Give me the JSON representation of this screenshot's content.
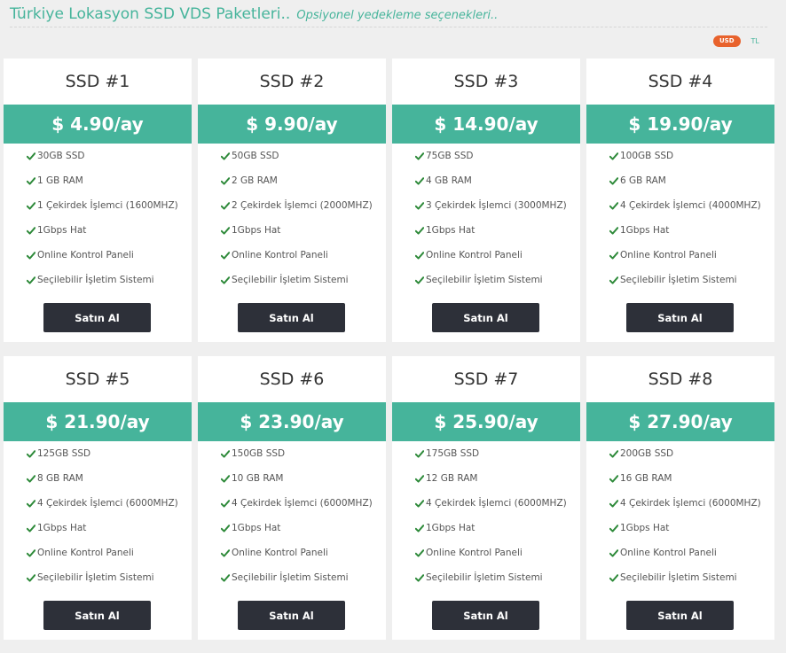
{
  "header": {
    "title": "Türkiye Lokasyon SSD VDS Paketleri..",
    "subtitle": "Opsiyonel yedekleme seçenekleri.."
  },
  "currency": {
    "active": "USD",
    "alt": "TL"
  },
  "plans": [
    {
      "name": "SSD #1",
      "price": "$ 4.90/ay",
      "features": [
        "30GB SSD",
        "1 GB RAM",
        "1 Çekirdek İşlemci (1600MHZ)",
        "1Gbps Hat",
        "Online Kontrol Paneli",
        "Seçilebilir İşletim Sistemi"
      ],
      "button": "Satın Al"
    },
    {
      "name": "SSD #2",
      "price": "$ 9.90/ay",
      "features": [
        "50GB SSD",
        "2 GB RAM",
        "2 Çekirdek İşlemci (2000MHZ)",
        "1Gbps Hat",
        "Online Kontrol Paneli",
        "Seçilebilir İşletim Sistemi"
      ],
      "button": "Satın Al"
    },
    {
      "name": "SSD #3",
      "price": "$ 14.90/ay",
      "features": [
        "75GB SSD",
        "4 GB RAM",
        "3 Çekirdek İşlemci (3000MHZ)",
        "1Gbps Hat",
        "Online Kontrol Paneli",
        "Seçilebilir İşletim Sistemi"
      ],
      "button": "Satın Al"
    },
    {
      "name": "SSD #4",
      "price": "$ 19.90/ay",
      "features": [
        "100GB SSD",
        "6 GB RAM",
        "4 Çekirdek İşlemci (4000MHZ)",
        "1Gbps Hat",
        "Online Kontrol Paneli",
        "Seçilebilir İşletim Sistemi"
      ],
      "button": "Satın Al"
    },
    {
      "name": "SSD #5",
      "price": "$ 21.90/ay",
      "features": [
        "125GB SSD",
        "8 GB RAM",
        "4 Çekirdek İşlemci (6000MHZ)",
        "1Gbps Hat",
        "Online Kontrol Paneli",
        "Seçilebilir İşletim Sistemi"
      ],
      "button": "Satın Al"
    },
    {
      "name": "SSD #6",
      "price": "$ 23.90/ay",
      "features": [
        "150GB SSD",
        "10 GB RAM",
        "4 Çekirdek İşlemci (6000MHZ)",
        "1Gbps Hat",
        "Online Kontrol Paneli",
        "Seçilebilir İşletim Sistemi"
      ],
      "button": "Satın Al"
    },
    {
      "name": "SSD #7",
      "price": "$ 25.90/ay",
      "features": [
        "175GB SSD",
        "12 GB RAM",
        "4 Çekirdek İşlemci (6000MHZ)",
        "1Gbps Hat",
        "Online Kontrol Paneli",
        "Seçilebilir İşletim Sistemi"
      ],
      "button": "Satın Al"
    },
    {
      "name": "SSD #8",
      "price": "$ 27.90/ay",
      "features": [
        "200GB SSD",
        "16 GB RAM",
        "4 Çekirdek İşlemci (6000MHZ)",
        "1Gbps Hat",
        "Online Kontrol Paneli",
        "Seçilebilir İşletim Sistemi"
      ],
      "button": "Satın Al"
    }
  ],
  "colors": {
    "accent": "#46b49b",
    "usd_badge": "#e8622c",
    "button": "#2d3039",
    "check": "#2e8a3a"
  },
  "icons": {
    "feature": "check-icon"
  }
}
